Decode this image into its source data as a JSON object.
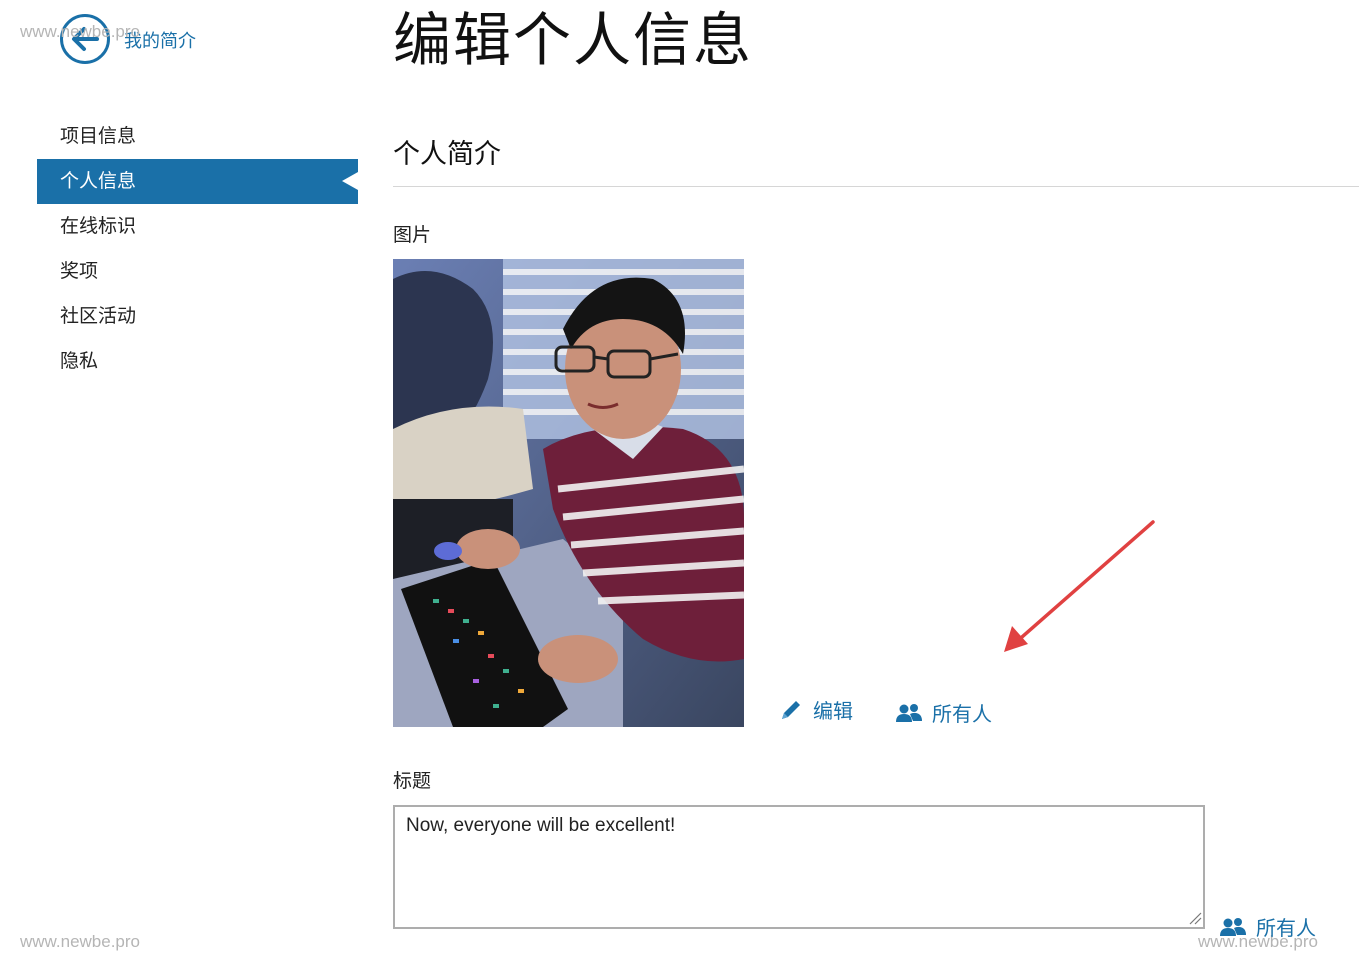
{
  "back": {
    "label": "我的简介"
  },
  "watermark": "www.newbe.pro",
  "sidebar": {
    "items": [
      {
        "label": "项目信息",
        "active": false
      },
      {
        "label": "个人信息",
        "active": true
      },
      {
        "label": "在线标识",
        "active": false
      },
      {
        "label": "奖项",
        "active": false
      },
      {
        "label": "社区活动",
        "active": false
      },
      {
        "label": "隐私",
        "active": false
      }
    ]
  },
  "page": {
    "title": "编辑个人信息",
    "section_title": "个人简介"
  },
  "picture": {
    "label": "图片",
    "edit_label": "编辑",
    "visibility_label": "所有人"
  },
  "headline": {
    "label": "标题",
    "value": "Now, everyone will be excellent!",
    "visibility_label": "所有人"
  },
  "colors": {
    "accent": "#1a70a8",
    "annotation_arrow": "#e04141"
  },
  "icons": {
    "back": "arrow-left-circle-icon",
    "edit": "pencil-icon",
    "visibility": "people-icon"
  }
}
